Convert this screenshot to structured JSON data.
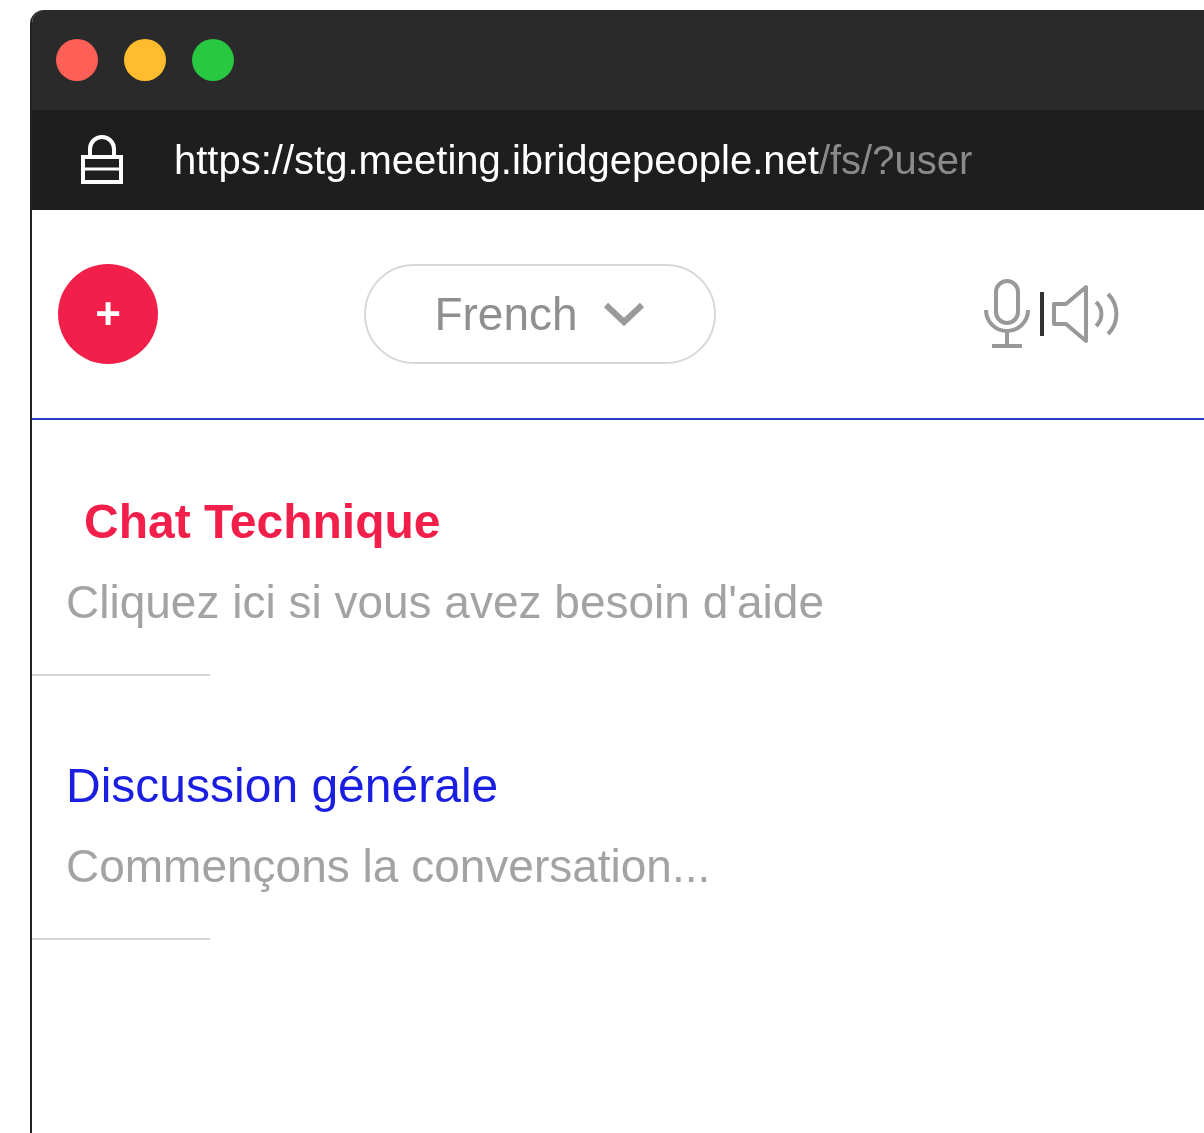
{
  "address_bar": {
    "url_host": "https://stg.meeting.ibridgepeople.net",
    "url_path": "/fs/?user"
  },
  "toolbar": {
    "add_button": "+",
    "language": "French"
  },
  "chats": [
    {
      "kind": "support",
      "title": "Chat Technique",
      "subtitle": "Cliquez ici si vous avez besoin d'aide"
    },
    {
      "kind": "channel",
      "title": "Discussion générale",
      "subtitle": "Commençons la conversation..."
    }
  ]
}
